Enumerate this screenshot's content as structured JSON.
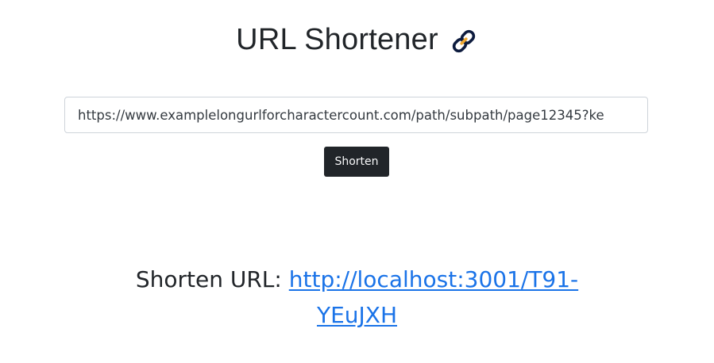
{
  "header": {
    "title": "URL Shortener",
    "icon": "link-icon",
    "icon_color_dark": "#0d1b3e",
    "icon_color_accent": "#f0a830"
  },
  "form": {
    "url_value": "https://www.examplelongurlforcharactercount.com/path/subpath/page12345?ke",
    "shorten_label": "Shorten"
  },
  "result": {
    "label": "Shorten URL:",
    "short_url": "http://localhost:3001/T91-YEuJXH"
  },
  "colors": {
    "button_bg": "#212529",
    "link": "#1a73e8",
    "text": "#212529"
  }
}
